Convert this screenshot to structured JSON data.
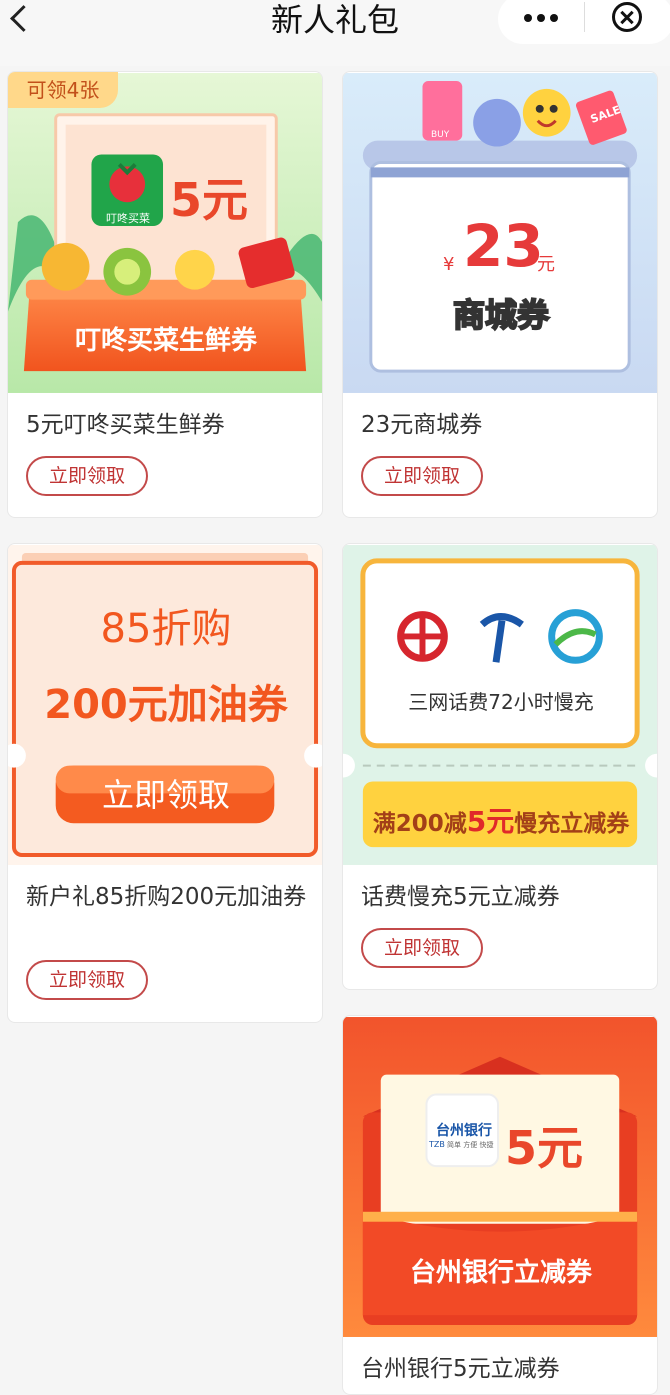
{
  "header": {
    "title": "新人礼包"
  },
  "cards": [
    {
      "badge": "可领4张",
      "logo_text": "叮咚买菜",
      "amount": "5元",
      "banner_label": "叮咚买菜生鲜券",
      "title": "5元叮咚买菜生鲜券",
      "button": "立即领取"
    },
    {
      "currency": "¥",
      "amount": "23",
      "unit": "元",
      "banner_label": "商城券",
      "tag": "SALE",
      "tag2": "BUY",
      "title": "23元商城券",
      "button": "立即领取"
    },
    {
      "line1": "85折购",
      "line2": "200元加油券",
      "banner_button": "立即领取",
      "title": "新户礼85折购200元加油券",
      "button": "立即领取"
    },
    {
      "subtitle": "三网话费72小时慢充",
      "offer_prefix": "满200减",
      "offer_amount": "5元",
      "offer_suffix": "慢充立减券",
      "title": "话费慢充5元立减券",
      "button": "立即领取"
    },
    {
      "bank_name": "台州银行",
      "bank_abbr": "TZB",
      "bank_slogan": "简单 方便 快捷",
      "amount": "5元",
      "banner_label": "台州银行立减券",
      "title": "台州银行5元立减券"
    }
  ],
  "colors": {
    "accent": "#c03434",
    "orange": "#f05a1e",
    "header_bg": "#f7f7f7"
  }
}
